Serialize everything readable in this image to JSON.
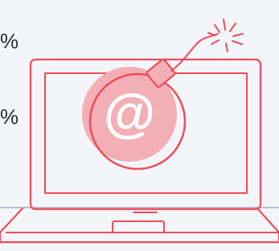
{
  "visible_text": {
    "top_percent": "%",
    "middle_percent": "%",
    "bomb_symbol": "@"
  },
  "icons": {
    "main": "laptop-icon",
    "overlay": "bomb-icon",
    "spark": "spark-icon"
  },
  "colors": {
    "background": "#f3f5f9",
    "accent_red": "#ef4b5a",
    "bomb_fill": "#f2b0b6",
    "bomb_inner": "#ffffff",
    "text_dark": "#2a2d33",
    "gray_line": "#b8bec8"
  }
}
